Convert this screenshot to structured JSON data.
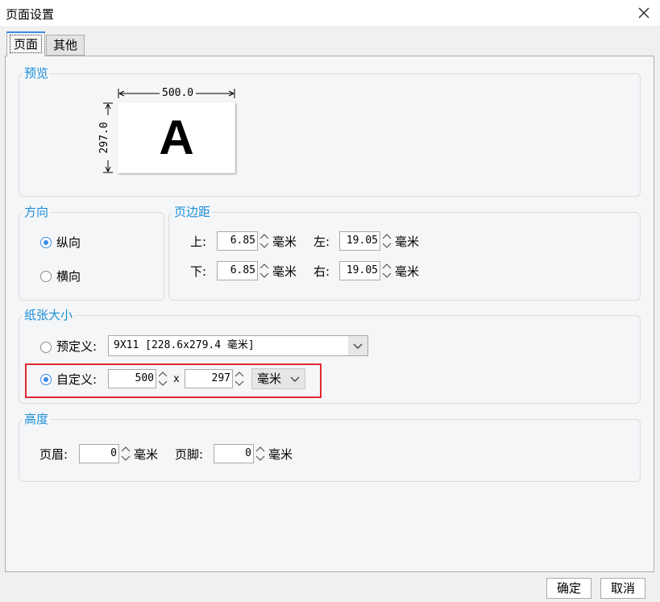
{
  "window": {
    "title": "页面设置"
  },
  "tabs": [
    {
      "label": "页面",
      "active": true
    },
    {
      "label": "其他",
      "active": false
    }
  ],
  "preview": {
    "group_label": "预览",
    "width_text": "500.0",
    "height_text": "297.0",
    "sample_letter": "A"
  },
  "orientation": {
    "group_label": "方向",
    "options": [
      {
        "label": "纵向",
        "selected": true
      },
      {
        "label": "横向",
        "selected": false
      }
    ]
  },
  "margins": {
    "group_label": "页边距",
    "top": {
      "label": "上:",
      "value": "6.85",
      "unit": "毫米"
    },
    "left": {
      "label": "左:",
      "value": "19.05",
      "unit": "毫米"
    },
    "bottom": {
      "label": "下:",
      "value": "6.85",
      "unit": "毫米"
    },
    "right": {
      "label": "右:",
      "value": "19.05",
      "unit": "毫米"
    }
  },
  "paper": {
    "group_label": "纸张大小",
    "predefined": {
      "label": "预定义:",
      "selected": false,
      "value": "9X11 [228.6x279.4 毫米]"
    },
    "custom": {
      "label": "自定义:",
      "selected": true,
      "width": "500",
      "times": "x",
      "height": "297",
      "unit": "毫米"
    }
  },
  "height": {
    "group_label": "高度",
    "header": {
      "label": "页眉:",
      "value": "0",
      "unit": "毫米"
    },
    "footer": {
      "label": "页脚:",
      "value": "0",
      "unit": "毫米"
    }
  },
  "buttons": {
    "ok": "确定",
    "cancel": "取消"
  },
  "colors": {
    "accent": "#1a8fd6",
    "radio": "#3c8be6",
    "highlight": "#e0282e"
  }
}
